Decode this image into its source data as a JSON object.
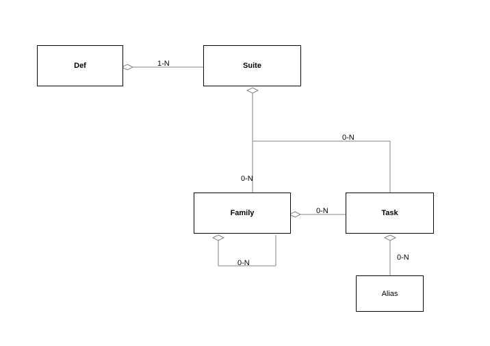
{
  "nodes": {
    "def": {
      "label": "Def"
    },
    "suite": {
      "label": "Suite"
    },
    "family": {
      "label": "Family"
    },
    "task": {
      "label": "Task"
    },
    "alias": {
      "label": "Alias"
    }
  },
  "edges": {
    "def_suite": {
      "card": "1-N"
    },
    "suite_family": {
      "card": "0-N"
    },
    "suite_task": {
      "card": "0-N"
    },
    "family_task": {
      "card": "0-N"
    },
    "family_family": {
      "card": "0-N"
    },
    "task_alias": {
      "card": "0-N"
    }
  }
}
